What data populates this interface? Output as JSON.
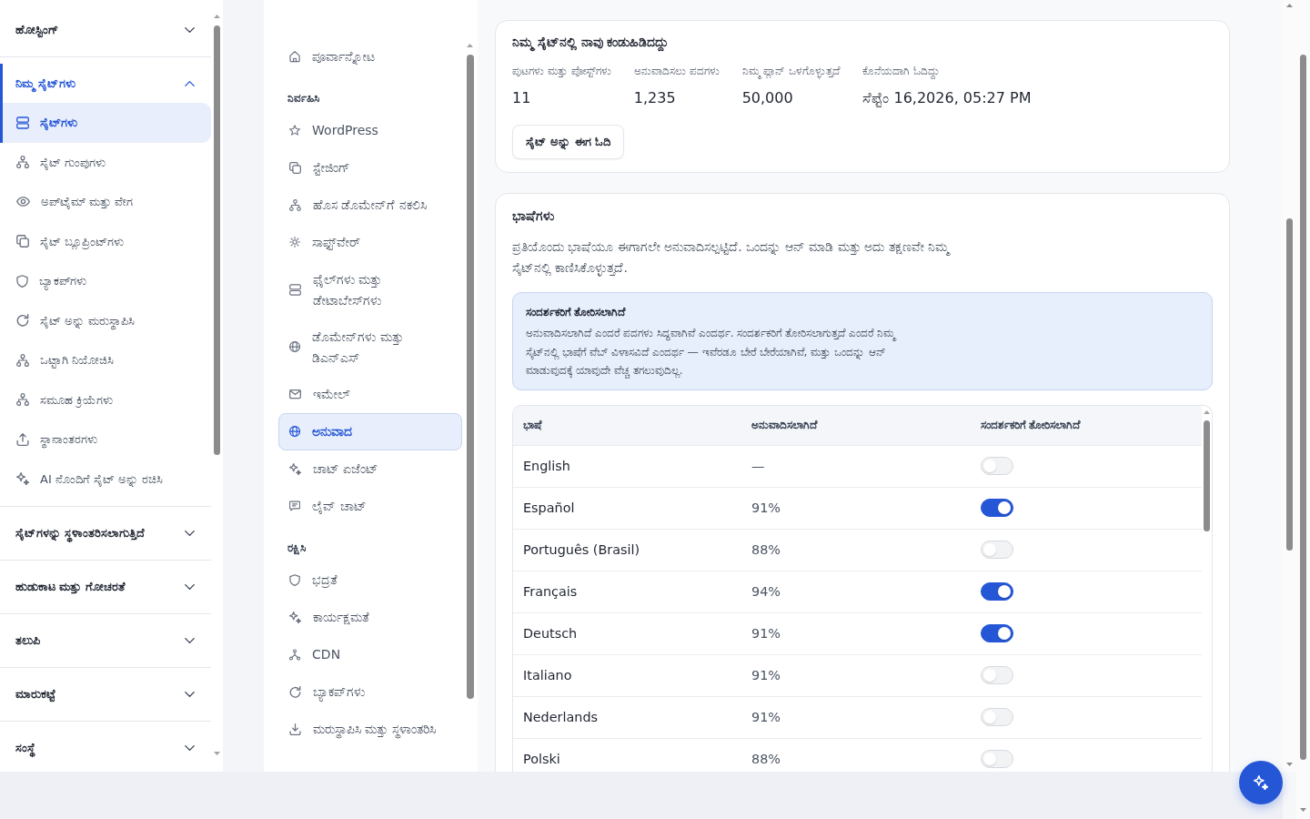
{
  "sidebar": {
    "groups": [
      {
        "label": "ಹೋಸ್ಟಿಂಗ್",
        "expanded": false
      },
      {
        "label": "ನಿಮ್ಮ ಸೈಟ್‌ಗಳು",
        "expanded": true,
        "items": [
          {
            "label": "ಸೈಟ್‌ಗಳು",
            "selected": true
          },
          {
            "label": "ಸೈಟ್ ಗುಂಪುಗಳು",
            "selected": false
          },
          {
            "label": "ಅಪ್‌ಟೈಮ್ ಮತ್ತು ವೇಗ",
            "selected": false
          },
          {
            "label": "ಸೈಟ್ ಬ್ಲೂಪ್ರಿಂಟ್‌ಗಳು",
            "selected": false
          },
          {
            "label": "ಬ್ಯಾಕಪ್‌ಗಳು",
            "selected": false
          },
          {
            "label": "ಸೈಟ್ ಅನ್ನು ಮರುಸ್ಥಾಪಿಸಿ",
            "selected": false
          },
          {
            "label": "ಒಟ್ಟಾಗಿ ನಿಯೋಜಿಸಿ",
            "selected": false
          },
          {
            "label": "ಸಮೂಹ ಕ್ರಿಯೆಗಳು",
            "selected": false
          },
          {
            "label": "ಸ್ಥಾನಾಂತರಗಳು",
            "selected": false
          },
          {
            "label": "AI ನೊಂದಿಗೆ ಸೈಟ್ ಅನ್ನು ರಚಿಸಿ",
            "selected": false
          }
        ]
      },
      {
        "label": "ಸೈಟ್‌ಗಳನ್ನು ಸ್ಥಳಾಂತರಿಸಲಾಗುತ್ತಿದೆ",
        "expanded": false
      },
      {
        "label": "ಹುಡುಕಾಟ ಮತ್ತು ಗೋಚರತೆ",
        "expanded": false
      },
      {
        "label": "ತಲುಪಿ",
        "expanded": false
      },
      {
        "label": "ಮಾರುಕಟ್ಟೆ",
        "expanded": false
      },
      {
        "label": "ಸಂಸ್ಥೆ",
        "expanded": false
      }
    ]
  },
  "site_menu": {
    "sections": [
      {
        "items": [
          {
            "label": "ಪೂರ್ವಾನ್ನೋಟ",
            "selected": false
          }
        ]
      },
      {
        "title": "ನಿರ್ವಹಿಸಿ",
        "items": [
          {
            "label": "WordPress",
            "selected": false
          },
          {
            "label": "ಸ್ಟೇಜಿಂಗ್",
            "selected": false
          },
          {
            "label": "ಹೊಸ ಡೊಮೇನ್‌ಗೆ ನಕಲಿಸಿ",
            "selected": false
          },
          {
            "label": "ಸಾಫ್ಟ್‌ವೇರ್",
            "selected": false
          },
          {
            "label": "ಫೈಲ್‌ಗಳು ಮತ್ತು ಡೇಟಾಬೇಸ್‌ಗಳು",
            "selected": false
          },
          {
            "label": "ಡೊಮೇನ್‌ಗಳು ಮತ್ತು ಡಿಎನ್‌ಎಸ್",
            "selected": false
          },
          {
            "label": "ಇಮೇಲ್",
            "selected": false
          },
          {
            "label": "ಅನುವಾದ",
            "selected": true
          },
          {
            "label": "ಚಾಟ್ ಏಜೆಂಟ್",
            "selected": false
          },
          {
            "label": "ಲೈವ್ ಚಾಟ್",
            "selected": false
          }
        ]
      },
      {
        "title": "ರಕ್ಷಿಸಿ",
        "items": [
          {
            "label": "ಭದ್ರತೆ",
            "selected": false
          },
          {
            "label": "ಕಾರ್ಯಕ್ಷಮತೆ",
            "selected": false
          },
          {
            "label": "CDN",
            "selected": false
          },
          {
            "label": "ಬ್ಯಾಕಪ್‌ಗಳು",
            "selected": false
          },
          {
            "label": "ಮರುಸ್ಥಾಪಿಸಿ ಮತ್ತು ಸ್ಥಳಾಂತರಿಸಿ",
            "selected": false
          }
        ]
      }
    ]
  },
  "summary": {
    "title": "ನಿಮ್ಮ ಸೈಟ್‌ನಲ್ಲಿ ನಾವು ಕಂಡುಹಿಡಿದದ್ದು",
    "stats": [
      {
        "label": "ಪುಟಗಳು ಮತ್ತು ಪೋಸ್ಟ್‌ಗಳು",
        "value": "11"
      },
      {
        "label": "ಅನುವಾದಿಸಲು ಪದಗಳು",
        "value": "1,235"
      },
      {
        "label": "ನಿಮ್ಮ ಪ್ಲಾನ್ ಒಳಗೊಳ್ಳುತ್ತದೆ",
        "value": "50,000"
      },
      {
        "label": "ಕೊನೆಯದಾಗಿ ಓದಿದ್ದು",
        "value": "ಸೆಪ್ಟೆಂ 16,2026, 05:27 PM"
      }
    ],
    "button": "ಸೈಟ್ ಅನ್ನು ಈಗ ಓದಿ"
  },
  "languages": {
    "title": "ಭಾಷೆಗಳು",
    "description": "ಪ್ರತಿಯೊಂದು ಭಾಷೆಯೂ ಈಗಾಗಲೇ ಅನುವಾದಿಸಲ್ಪಟ್ಟಿದೆ. ಒಂದನ್ನು ಆನ್ ಮಾಡಿ ಮತ್ತು ಅದು ತಕ್ಷಣವೇ ನಿಮ್ಮ ಸೈಟ್‌ನಲ್ಲಿ ಕಾಣಿಸಿಕೊಳ್ಳುತ್ತದೆ.",
    "notice": {
      "title": "ಸಂದರ್ಶಕರಿಗೆ ತೋರಿಸಲಾಗಿದೆ",
      "text": "ಅನುವಾದಿಸಲಾಗಿದೆ ಎಂದರೆ ಪದಗಳು ಸಿದ್ಧವಾಗಿವೆ ಎಂದರ್ಥ. ಸಂದರ್ಶಕರಿಗೆ ತೋರಿಸಲಾಗುತ್ತದೆ ಎಂದರೆ ನಿಮ್ಮ ಸೈಟ್‌ನಲ್ಲಿ ಭಾಷೆಗೆ ವೆಬ್ ವಿಳಾಸವಿದೆ ಎಂದರ್ಥ — ಇವೆರಡೂ ಬೇರೆ ಬೇರೆಯಾಗಿವೆ, ಮತ್ತು ಒಂದನ್ನು ಆನ್ ಮಾಡುವುದಕ್ಕೆ ಯಾವುದೇ ವೆಚ್ಚ ತಗಲುವುದಿಲ್ಲ."
    },
    "table": {
      "columns": [
        "ಭಾಷೆ",
        "ಅನುವಾದಿಸಲಾಗಿದೆ",
        "ಸಂದರ್ಶಕರಿಗೆ ತೋರಿಸಲಾಗಿದೆ"
      ],
      "rows": [
        {
          "language": "English",
          "translated": "—",
          "shown": false
        },
        {
          "language": "Español",
          "translated": "91%",
          "shown": true
        },
        {
          "language": "Português (Brasil)",
          "translated": "88%",
          "shown": false
        },
        {
          "language": "Français",
          "translated": "94%",
          "shown": true
        },
        {
          "language": "Deutsch",
          "translated": "91%",
          "shown": true
        },
        {
          "language": "Italiano",
          "translated": "91%",
          "shown": false
        },
        {
          "language": "Nederlands",
          "translated": "91%",
          "shown": false
        },
        {
          "language": "Polski",
          "translated": "88%",
          "shown": false
        }
      ]
    }
  }
}
